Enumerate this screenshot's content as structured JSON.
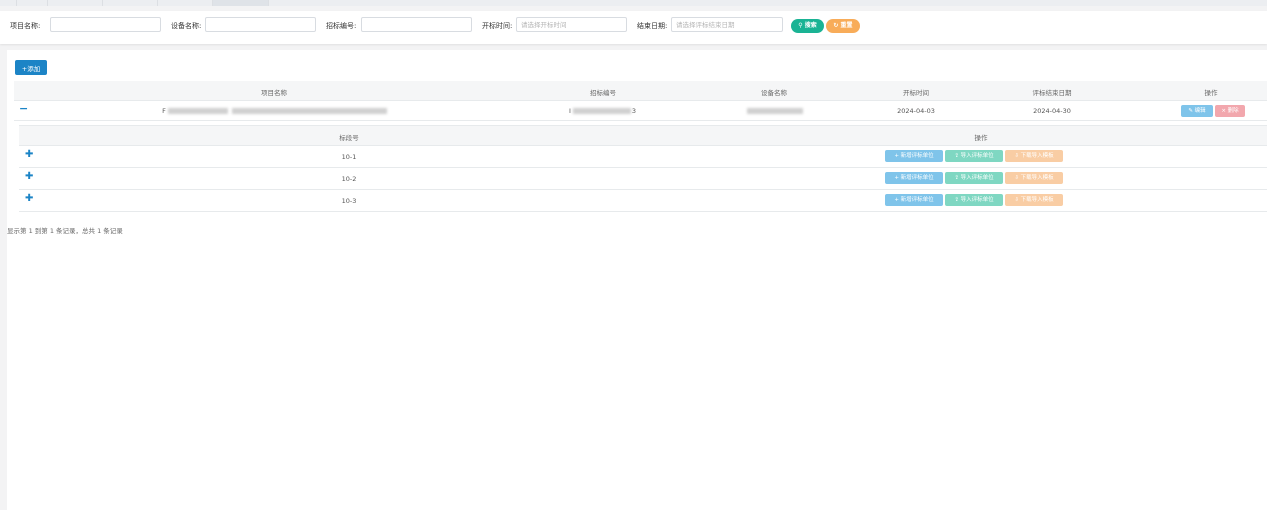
{
  "search": {
    "project_name_label": "项目名称:",
    "project_name_value": "",
    "device_name_label": "设备名称:",
    "device_name_value": "",
    "bid_no_label": "招标编号:",
    "bid_no_value": "",
    "open_time_label": "开标时间:",
    "open_time_placeholder": "请选择开标时间",
    "end_date_label": "结束日期:",
    "end_date_placeholder": "请选择评标结束日期",
    "search_btn": "搜索",
    "reset_btn": "重置"
  },
  "toolbar": {
    "add_label": "添加"
  },
  "table": {
    "columns": [
      "项目名称",
      "招标编号",
      "设备名称",
      "开标时间",
      "评标结束日期",
      "操作"
    ],
    "rows": [
      {
        "project_name": "F",
        "bid_no_prefix": "I",
        "bid_no_suffix": "3",
        "device_name": "",
        "open_time": "2024-04-03",
        "end_date": "2024-04-30",
        "edit_label": "编辑",
        "delete_label": "删除"
      }
    ]
  },
  "subtable": {
    "columns": [
      "标段号",
      "操作"
    ],
    "rows": [
      {
        "section_no": "10-1"
      },
      {
        "section_no": "10-2"
      },
      {
        "section_no": "10-3"
      }
    ],
    "actions": {
      "add_unit": "新增评标单位",
      "import_unit": "导入评标单位",
      "download_template": "下载导入模板"
    }
  },
  "footer": {
    "summary": "显示第 1 到第 1 条记录，总共 1 条记录"
  },
  "colors": {
    "primary": "#1c84c6",
    "success": "#1ab394",
    "warning": "#f8ac59",
    "danger": "#ed5565"
  }
}
